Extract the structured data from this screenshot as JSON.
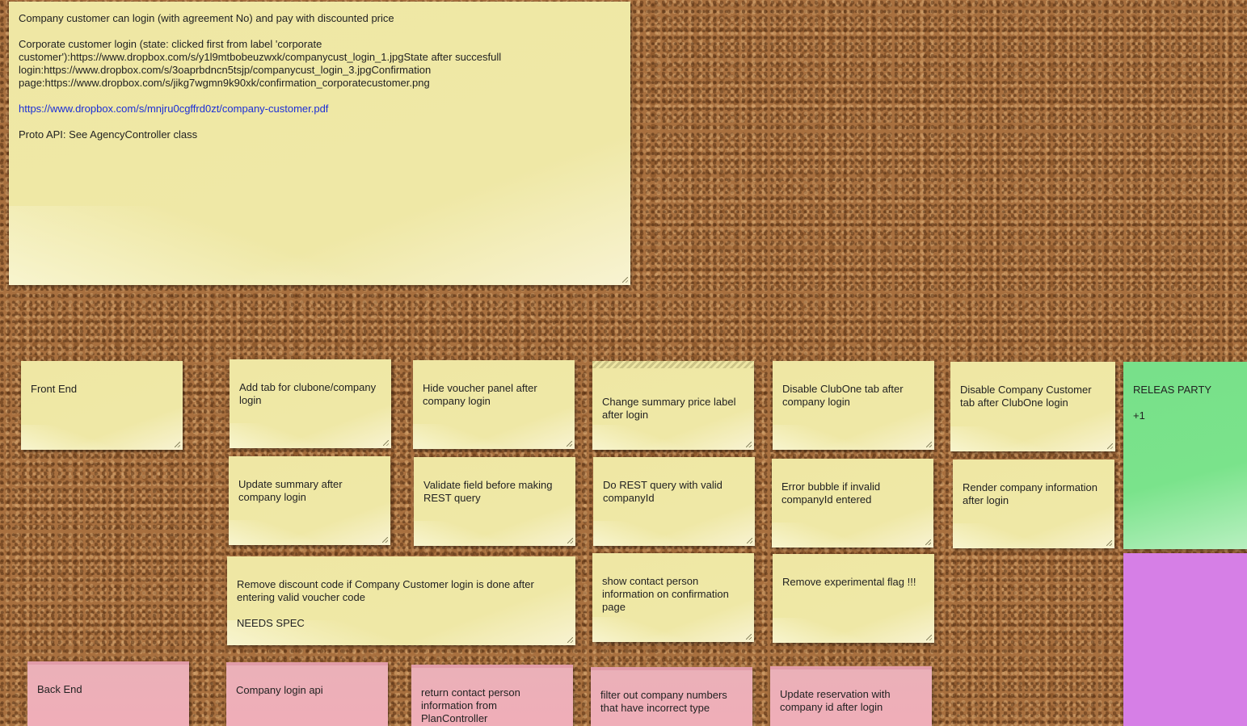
{
  "main_note": {
    "title": "Company customer can login (with agreement No) and pay with discounted price",
    "body": "Corporate customer login (state: clicked first from label 'corporate customer'):https://www.dropbox.com/s/y1l9mtbobeuzwxk/companycust_login_1.jpgState after succesfull login:https://www.dropbox.com/s/3oaprbdncn5tsjp/companycust_login_3.jpgConfirmation page:https://www.dropbox.com/s/jikg7wgmn9k90xk/confirmation_corporatecustomer.png",
    "link": "https://www.dropbox.com/s/mnjru0cgffrd0zt/company-customer.pdf",
    "footer": "Proto API: See AgencyController class"
  },
  "notes": {
    "front_end": "Front End",
    "add_tab": "Add tab for clubone/company login",
    "hide_voucher": "Hide voucher panel after company login",
    "change_summary": "Change summary price label after login",
    "disable_clubone": "Disable ClubOne tab after company login",
    "disable_company": "Disable Company Customer tab after ClubOne login",
    "releas_party": "RELEAS PARTY\n\n+1",
    "update_summary": "Update summary after company login",
    "validate_field": "Validate field before making REST query",
    "do_rest": "Do REST query with valid companyId",
    "error_bubble": "Error bubble if invalid companyId entered",
    "render_company": "Render company information after login",
    "remove_discount": "Remove discount code if Company Customer login is done after entering valid voucher code\n\nNEEDS SPEC",
    "show_contact": "show contact person information on confirmation page",
    "remove_flag": "Remove experimental flag !!!",
    "back_end": "Back End",
    "company_login_api": "Company login api",
    "return_contact": "return contact person information from PlanController",
    "filter_out": "filter out company numbers that have incorrect type",
    "update_reservation": "Update reservation with company id after login"
  }
}
